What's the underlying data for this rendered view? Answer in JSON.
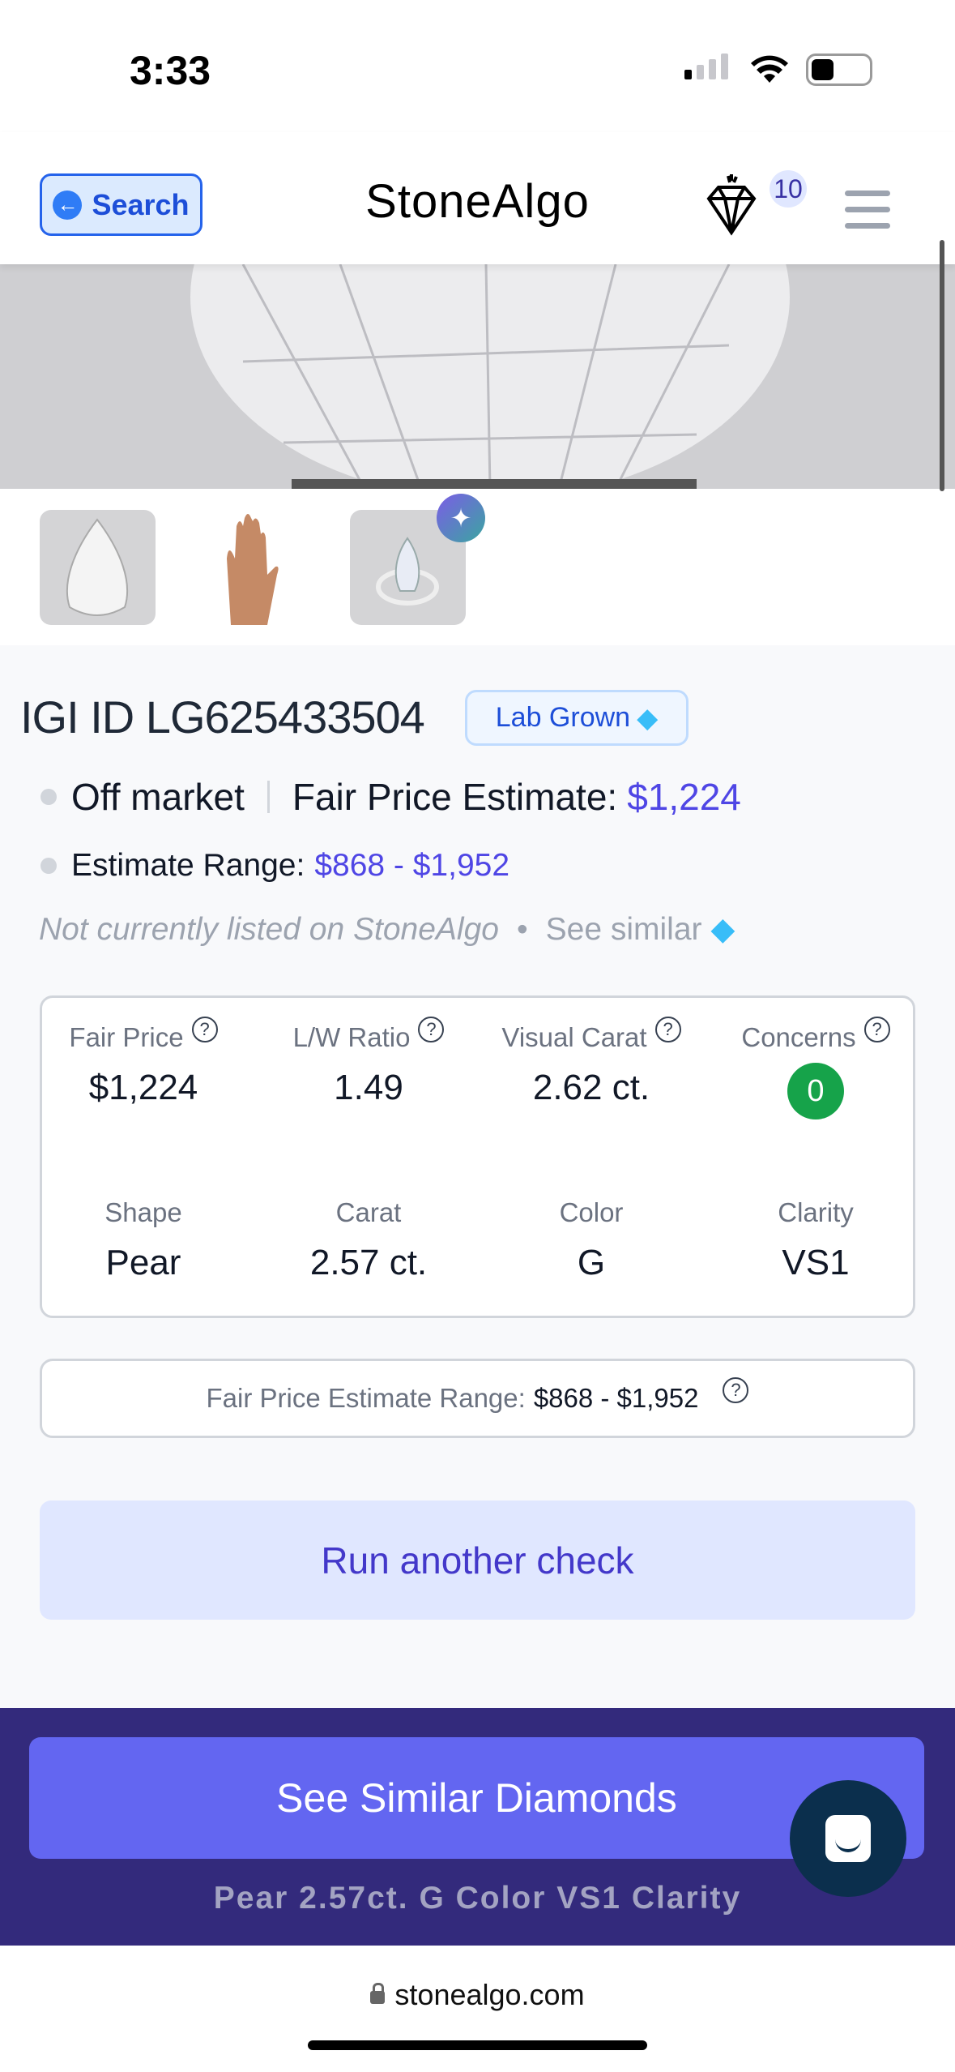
{
  "status_bar": {
    "time": "3:33"
  },
  "header": {
    "search_label": "Search",
    "logo": "StoneAlgo",
    "saved_count": "10"
  },
  "diamond": {
    "title": "IGI ID LG625433504",
    "lab_badge": "Lab Grown",
    "market_status": "Off market",
    "fair_price_label": "Fair Price Estimate:",
    "fair_price": "$1,224",
    "range_label": "Estimate Range:",
    "range": "$868 - $1,952",
    "note": "Not currently listed on StoneAlgo",
    "see_similar": "See similar"
  },
  "specs": [
    {
      "label": "Fair Price",
      "value": "$1,224",
      "help": true
    },
    {
      "label": "L/W Ratio",
      "value": "1.49",
      "help": true
    },
    {
      "label": "Visual Carat",
      "value": "2.62 ct.",
      "help": true
    },
    {
      "label": "Concerns",
      "value": "0",
      "help": true
    },
    {
      "label": "Shape",
      "value": "Pear"
    },
    {
      "label": "Carat",
      "value": "2.57 ct."
    },
    {
      "label": "Color",
      "value": "G"
    },
    {
      "label": "Clarity",
      "value": "VS1"
    }
  ],
  "range_box": {
    "label": "Fair Price Estimate Range:",
    "value": "$868 - $1,952"
  },
  "run_check": "Run another check",
  "cta": {
    "label": "See Similar Diamonds",
    "subtitle": "Pear 2.57ct. G Color VS1 Clarity"
  },
  "browser": {
    "url": "stonealgo.com"
  },
  "colors": {
    "accent": "#4f46e5",
    "cta": "#6366f1",
    "footer": "#332a7c",
    "concerns_ok": "#16a34a"
  }
}
